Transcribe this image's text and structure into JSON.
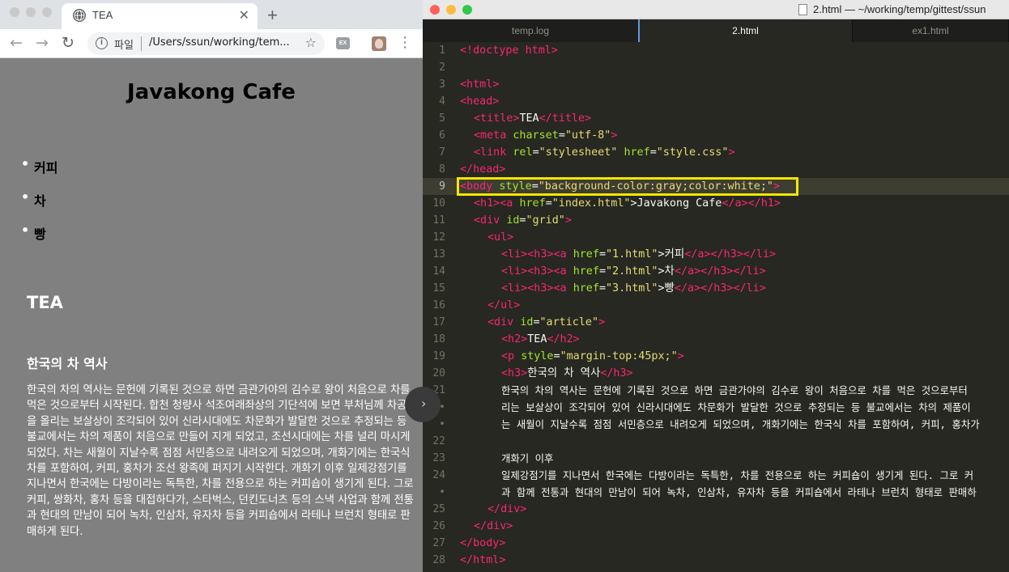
{
  "browser": {
    "tab_title": "TEA",
    "close_glyph": "✕",
    "new_tab_glyph": "+",
    "address_scheme": "파일",
    "address_url": "/Users/ssun/working/tem...",
    "extension_label": "EX",
    "page": {
      "h1": "Javakong Cafe",
      "menu_items": [
        "커피",
        "차",
        "빵"
      ],
      "h2": "TEA",
      "h3": "한국의 차 역사",
      "paragraph": "한국의 차의 역사는 문헌에 기록된 것으로 하면 금관가야의 김수로 왕이 처음으로 차를 먹은 것으로부터 시작된다. 합천 청량사 석조여래좌상의 기단석에 보면 부처님께 차공양을 올리는 보살상이 조각되어 있어 신라시대에도 차문화가 발달한 것으로 추정되는 등 불교에서는 차의 제품이 처음으로 만들어 지게 되었고, 조선시대에는 차를 널리 마시게 되었다. 차는 새월이 지날수록 점점 서민층으로 내려오게 되었으며, 개화기에는 한국식 차를 포함하여, 커피, 홍차가 조선 왕족에 퍼지기 시작한다. 개화기 이후 일제강점기를 지나면서 한국에는 다방이라는 독특한, 차를 전용으로 하는 커피숍이 생기게 된다. 그로 커피, 쌍화차, 홍차 등을 대접하다가, 스타벅스, 던킨도너츠 등의 스낵 사업과 함께 전통과 현대의 만남이 되어 녹차, 인삼차, 유자차 등을 커피숍에서 라테나 브런치 형태로 판매하게 된다."
    }
  },
  "editor": {
    "window_title": "2.html — ~/working/temp/gittest/ssun",
    "tabs": [
      "temp.log",
      "2.html",
      "ex1.html"
    ],
    "active_tab": "2.html",
    "line_numbers": [
      "1",
      "2",
      "3",
      "4",
      "5",
      "6",
      "7",
      "8",
      "9",
      "10",
      "11",
      "12",
      "13",
      "14",
      "15",
      "16",
      "17",
      "18",
      "19",
      "20",
      "21",
      "•",
      "•",
      "22",
      "23",
      "24",
      "•",
      "25",
      "26",
      "27",
      "28"
    ],
    "code": {
      "l1": "<!doctype html>",
      "l3": "<html>",
      "l4": "<head>",
      "l5_tag_open": "<title>",
      "l5_text": "TEA",
      "l5_tag_close": "</title>",
      "l6_tag": "<meta",
      "l6_attr": "charset",
      "l6_eq": "=",
      "l6_str": "\"utf-8\"",
      "l6_end": ">",
      "l7_tag": "<link",
      "l7_attr1": "rel",
      "l7_str1": "\"stylesheet\"",
      "l7_attr2": "href",
      "l7_str2": "\"style.css\"",
      "l7_end": ">",
      "l8": "</head>",
      "l9_tag": "<body",
      "l9_attr": "style",
      "l9_str": "\"background-color:gray;color:white;\"",
      "l9_end": ">",
      "l10_a": "<h1><a",
      "l10_attr": "href",
      "l10_str": "\"index.html\"",
      "l10_text": ">Javakong Cafe",
      "l10_end": "</a></h1>",
      "l11_tag": "<div",
      "l11_attr": "id",
      "l11_str": "\"grid\"",
      "l11_end": ">",
      "l12": "<ul>",
      "l13_a": "<li><h3><a",
      "l13_attr": "href",
      "l13_str": "\"1.html\"",
      "l13_text": ">커피",
      "l13_end": "</a></h3></li>",
      "l14_a": "<li><h3><a",
      "l14_attr": "href",
      "l14_str": "\"2.html\"",
      "l14_text": ">차",
      "l14_end": "</a></h3></li>",
      "l15_a": "<li><h3><a",
      "l15_attr": "href",
      "l15_str": "\"3.html\"",
      "l15_text": ">빵",
      "l15_end": "</a></h3></li>",
      "l16": "</ul>",
      "l17_tag": "<div",
      "l17_attr": "id",
      "l17_str": "\"article\"",
      "l17_end": ">",
      "l18_open": "<h2>",
      "l18_text": "TEA",
      "l18_close": "</h2>",
      "l19_tag": "<p",
      "l19_attr": "style",
      "l19_str": "\"margin-top:45px;\"",
      "l19_end": ">",
      "l20_open": "<h3>",
      "l20_text": "한국의 차 역사",
      "l20_close": "</h3>",
      "l21a": "한국의 차의 역사는 문헌에 기록된 것으로 하면 금관가야의 김수로 왕이 처음으로 차를 먹은 것으로부터",
      "l21b": "리는 보살상이 조각되어 있어 신라시대에도 차문화가 발달한 것으로 추정되는 등 불교에서는 차의 제품이",
      "l21c": "는 새월이 지날수록 점점 서민층으로 내려오게 되었으며, 개화기에는 한국식 차를 포함하여, 커피, 홍차가",
      "l23": "개화기 이후",
      "l24a": "일제강점기를 지나면서 한국에는 다방이라는 독특한, 차를 전용으로 하는 커피숍이 생기게 된다. 그로 커",
      "l24b": "과 함께 전통과 현대의 만남이 되어 녹차, 인삼차, 유자차 등을 커피숍에서 라테나 브런치 형태로 판매하",
      "l25": "</div>",
      "l26": "</div>",
      "l27": "</body>",
      "l28": "</html>"
    }
  },
  "colors": {
    "page_background": "#808080",
    "editor_background": "#272822",
    "tag": "#f92672",
    "attribute": "#a6e22e",
    "string": "#e6db74",
    "highlight_box": "#f5e600"
  }
}
